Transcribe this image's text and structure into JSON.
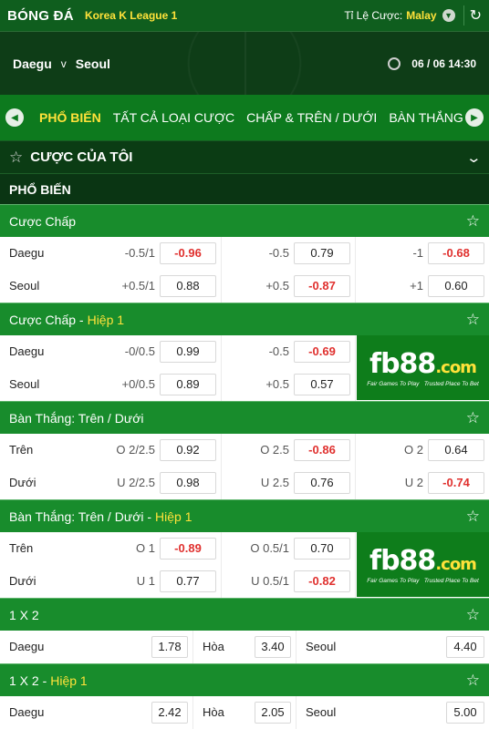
{
  "header": {
    "sport": "BÓNG ĐÁ",
    "league": "Korea K League 1",
    "odds_label": "Tỉ Lệ Cược:",
    "odds_type": "Malay"
  },
  "match": {
    "home": "Daegu",
    "vs": "v",
    "away": "Seoul",
    "datetime": "06 / 06  14:30"
  },
  "tabs": [
    "PHỔ BIẾN",
    "TẤT CẢ LOẠI CƯỢC",
    "CHẤP & TRÊN / DƯỚI",
    "BÀN THẮNG"
  ],
  "my_bets": "CƯỢC CỦA TÔI",
  "section": "PHỔ BIẾN",
  "markets": [
    {
      "title": "Cược Chấp",
      "highlight": "",
      "rows": [
        {
          "name": "Daegu",
          "cells": [
            {
              "hc": "-0.5/1",
              "odds": "-0.96"
            },
            {
              "hc": "-0.5",
              "odds": "0.79"
            },
            {
              "hc": "-1",
              "odds": "-0.68"
            }
          ]
        },
        {
          "name": "Seoul",
          "cells": [
            {
              "hc": "+0.5/1",
              "odds": "0.88"
            },
            {
              "hc": "+0.5",
              "odds": "-0.87"
            },
            {
              "hc": "+1",
              "odds": "0.60"
            }
          ]
        }
      ]
    },
    {
      "title": "Cược Chấp -",
      "highlight": "Hiệp 1",
      "rows": [
        {
          "name": "Daegu",
          "cells": [
            {
              "hc": "-0/0.5",
              "odds": "0.99"
            },
            {
              "hc": "-0.5",
              "odds": "-0.69"
            }
          ]
        },
        {
          "name": "Seoul",
          "cells": [
            {
              "hc": "+0/0.5",
              "odds": "0.89"
            },
            {
              "hc": "+0.5",
              "odds": "0.57"
            }
          ]
        }
      ]
    },
    {
      "title": "Bàn Thắng: Trên / Dưới",
      "highlight": "",
      "rows": [
        {
          "name": "Trên",
          "cells": [
            {
              "hc": "O  2/2.5",
              "odds": "0.92"
            },
            {
              "hc": "O  2.5",
              "odds": "-0.86"
            },
            {
              "hc": "O  2",
              "odds": "0.64"
            }
          ]
        },
        {
          "name": "Dưới",
          "cells": [
            {
              "hc": "U  2/2.5",
              "odds": "0.98"
            },
            {
              "hc": "U  2.5",
              "odds": "0.76"
            },
            {
              "hc": "U  2",
              "odds": "-0.74"
            }
          ]
        }
      ]
    },
    {
      "title": "Bàn Thắng: Trên / Dưới -",
      "highlight": "Hiệp 1",
      "rows": [
        {
          "name": "Trên",
          "cells": [
            {
              "hc": "O  1",
              "odds": "-0.89"
            },
            {
              "hc": "O  0.5/1",
              "odds": "0.70"
            }
          ]
        },
        {
          "name": "Dưới",
          "cells": [
            {
              "hc": "U  1",
              "odds": "0.77"
            },
            {
              "hc": "U  0.5/1",
              "odds": "-0.82"
            }
          ]
        }
      ]
    }
  ],
  "x12": [
    {
      "title": "1 X 2",
      "highlight": "",
      "row": {
        "home": "Daegu",
        "home_odds": "1.78",
        "draw": "Hòa",
        "draw_odds": "3.40",
        "away": "Seoul",
        "away_odds": "4.40"
      }
    },
    {
      "title": "1 X 2 -",
      "highlight": "Hiệp 1",
      "row": {
        "home": "Daegu",
        "home_odds": "2.42",
        "draw": "Hòa",
        "draw_odds": "2.05",
        "away": "Seoul",
        "away_odds": "5.00"
      }
    }
  ],
  "ad": {
    "logo_main": "fb88",
    "logo_suffix": ".com",
    "tag1": "Fair Games To Play",
    "tag2": "Trusted Place To Bet"
  },
  "colors": {
    "header_bg": "#0f5e1e",
    "market_bg": "#188c2c",
    "accent": "#ffe23a",
    "negative": "#e0312f"
  }
}
